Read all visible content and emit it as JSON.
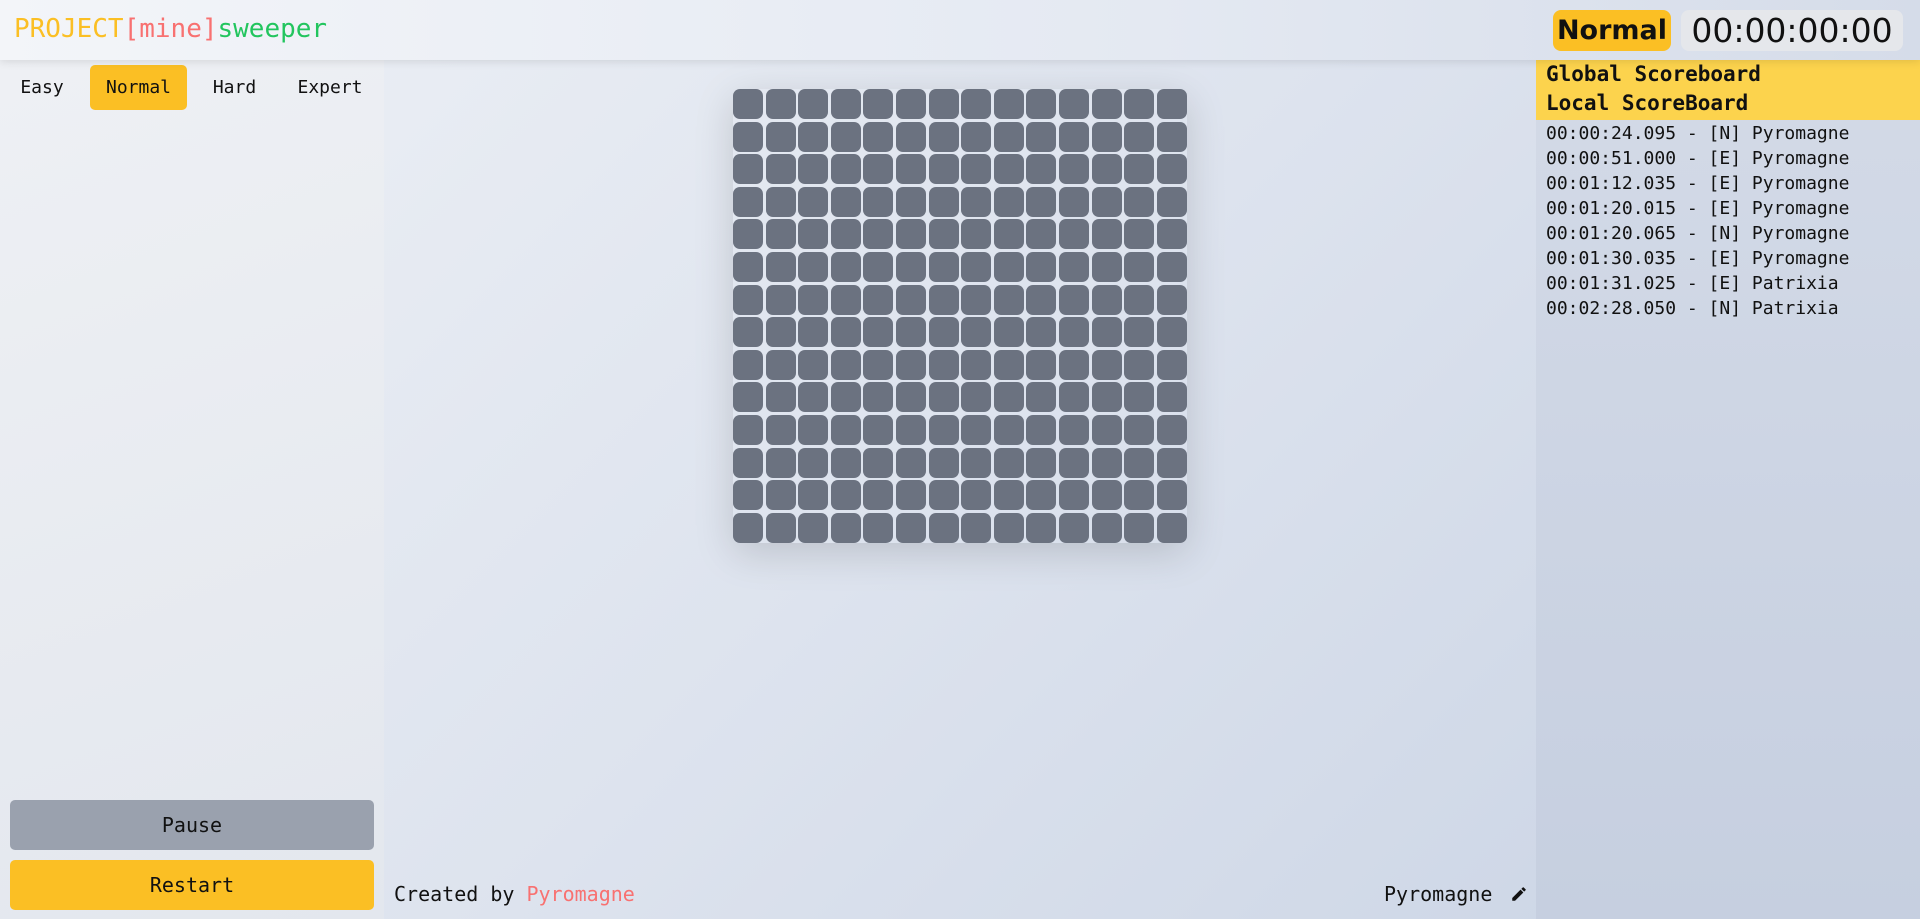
{
  "header": {
    "logo": {
      "part1": "PROJECT",
      "part2": "[mine]",
      "part3": "sweeper"
    },
    "mode": "Normal",
    "timer": "00:00:00:00"
  },
  "difficulty": {
    "options": [
      "Easy",
      "Normal",
      "Hard",
      "Expert"
    ],
    "selected": "Normal"
  },
  "controls": {
    "pause_label": "Pause",
    "restart_label": "Restart"
  },
  "board": {
    "rows": 14,
    "cols": 14
  },
  "footer": {
    "credit_prefix": "Created by",
    "author": "Pyromagne",
    "username": "Pyromagne",
    "edit_icon": "pencil-icon"
  },
  "scoreboard": {
    "global_label": "Global Scoreboard",
    "local_label": "Local ScoreBoard",
    "entries": [
      "00:00:24.095 - [N] Pyromagne",
      "00:00:51.000 - [E] Pyromagne",
      "00:01:12.035 - [E] Pyromagne",
      "00:01:20.015 - [E] Pyromagne",
      "00:01:20.065 - [N] Pyromagne",
      "00:01:30.035 - [E] Pyromagne",
      "00:01:31.025 - [E] Patrixia",
      "00:02:28.050 - [N] Patrixia"
    ]
  },
  "colors": {
    "accent": "#fbbf24",
    "cell": "#6b7280",
    "logo_project": "#fbbf24",
    "logo_mine": "#f87171",
    "logo_sweeper": "#22c55e",
    "pause_button": "#9aa1ae"
  }
}
